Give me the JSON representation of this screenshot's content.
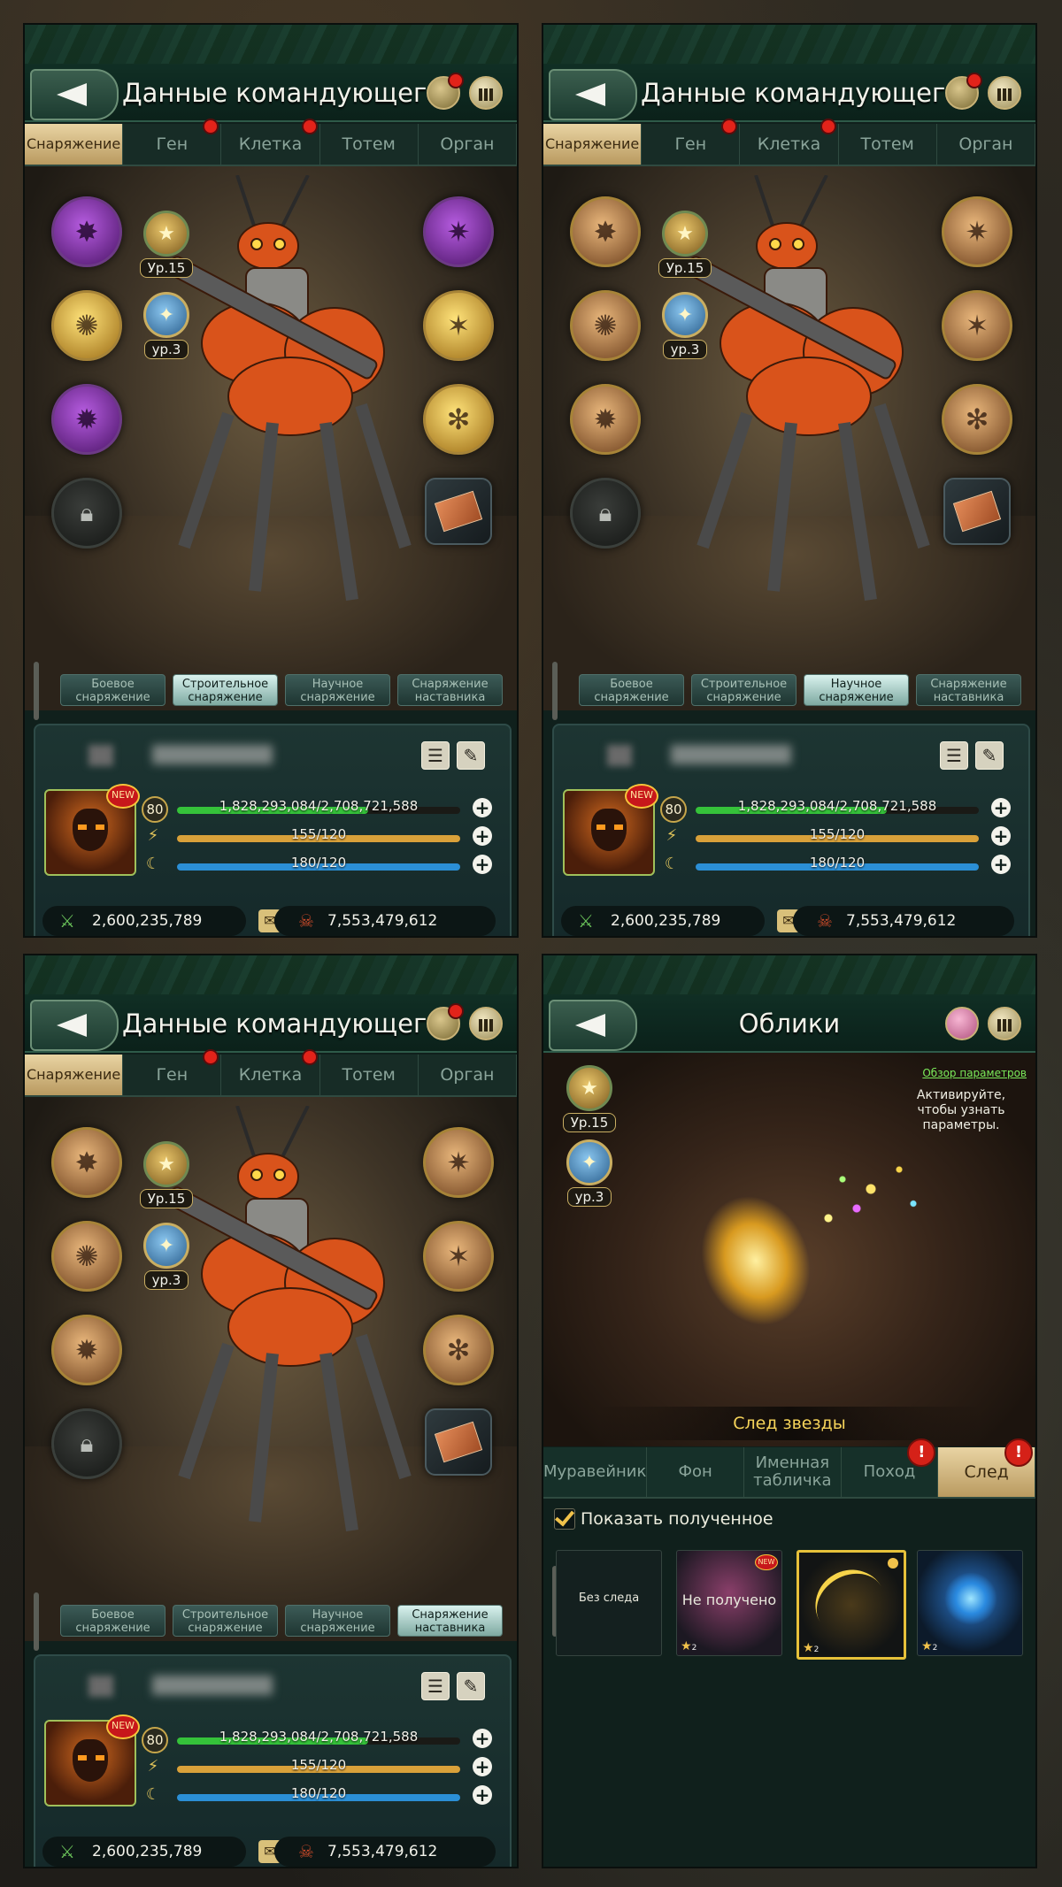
{
  "panels": {
    "commander": {
      "title": "Данные командующего",
      "tabs": [
        "Снаряжение",
        "Ген",
        "Клетка",
        "Тотем",
        "Орган"
      ],
      "rank_level": "Ур.15",
      "rank_level2": "ур.3",
      "equipment_tabs": [
        "Боевое снаряжение",
        "Строительное снаряжение",
        "Научное снаряжение",
        "Снаряжение наставника"
      ],
      "info": {
        "new_badge": "NEW",
        "level": "80",
        "hp_text": "1,828,293,084/2,708,721,588",
        "hp_fraction": 0.675,
        "energy_text": "155/120",
        "stamina_text": "180/120",
        "power": "2,600,235,789",
        "kills": "7,553,479,612"
      },
      "active_equipment_tab": [
        1,
        2,
        3
      ]
    },
    "skins": {
      "title": "Облики",
      "rank_level": "Ур.15",
      "rank_level2": "ур.3",
      "link": "Обзор параметров",
      "hint": "Активируйте, чтобы узнать параметры.",
      "skin_name": "След звезды",
      "tabs": [
        "Муравейник",
        "Фон",
        "Именная табличка",
        "Поход",
        "След"
      ],
      "show_owned": "Показать полученное",
      "cards": [
        {
          "label": "Без следа",
          "stars": ""
        },
        {
          "label": "Не получено",
          "stars": "2",
          "new": "NEW"
        },
        {
          "label": "",
          "stars": "2"
        },
        {
          "label": "",
          "stars": "2"
        }
      ]
    }
  },
  "colors": {
    "hp_bar": "#35c23a",
    "energy_bar": "#d9a13a",
    "stamina_bar": "#2b8fd6",
    "accent_gold": "#f6d45a"
  },
  "icons": {
    "back": "back-arrow-icon",
    "ranking": "ranking-bars-icon",
    "star_badge": "star-icon",
    "edit": "edit-icon",
    "list": "list-icon"
  }
}
